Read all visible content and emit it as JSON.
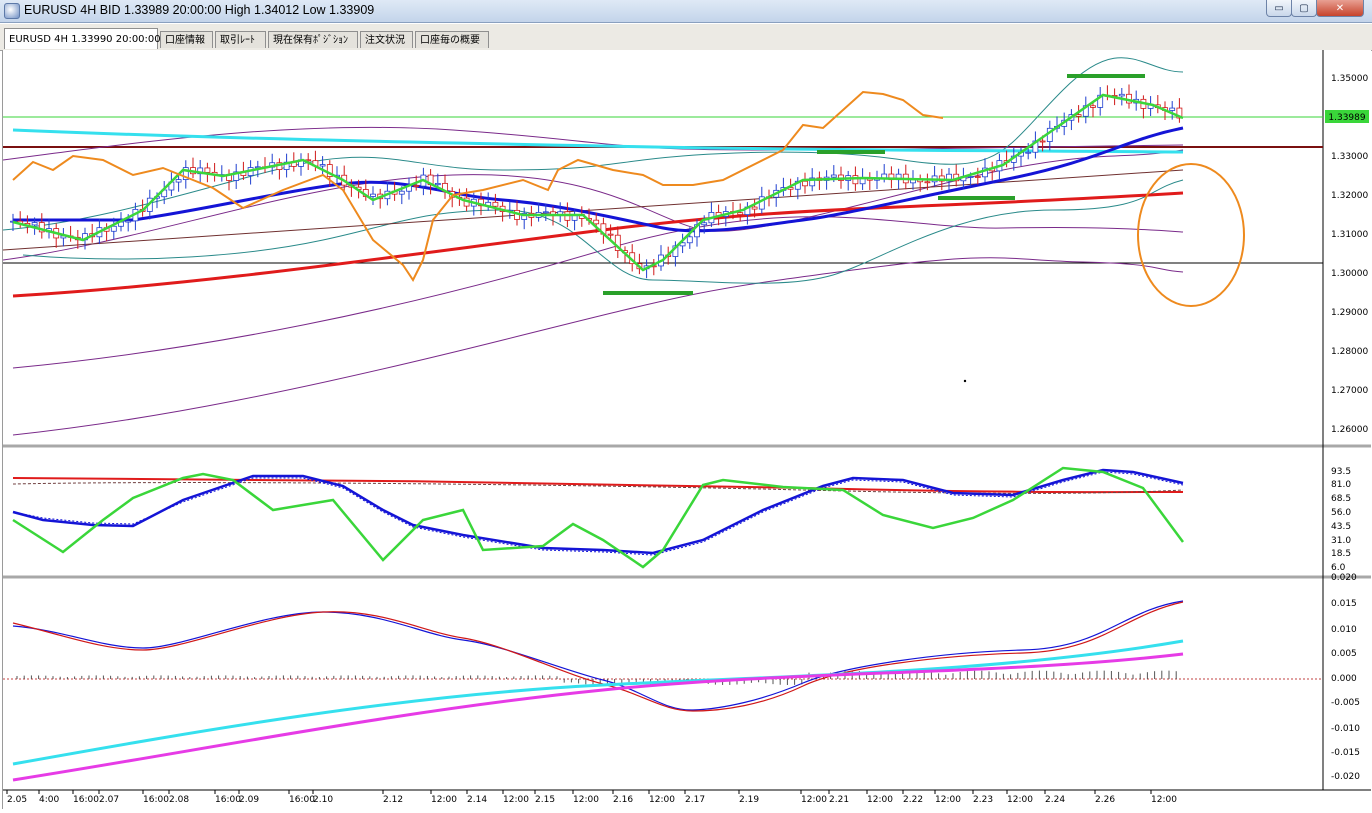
{
  "window": {
    "title": "EURUSD 4H BID 1.33989 20:00:00 High 1.34012 Low 1.33909",
    "buttons": {
      "minimize": "▭",
      "maximize": "▢",
      "close": "✕"
    }
  },
  "tabs": [
    {
      "label": "EURUSD 4H 1.33990 20:00:00"
    },
    {
      "label": "口座情報"
    },
    {
      "label": "取引ﾚｰﾄ"
    },
    {
      "label": "現在保有ﾎﾟｼﾞｼｮﾝ"
    },
    {
      "label": "注文状況"
    },
    {
      "label": "口座毎の概要"
    }
  ],
  "price_axis": {
    "labels": [
      "1.35000",
      "1.34000",
      "1.33000",
      "1.32000",
      "1.31000",
      "1.30000",
      "1.29000",
      "1.28000",
      "1.27000",
      "1.26000"
    ],
    "current": "1.33989"
  },
  "osc_axis": {
    "labels": [
      "93.5",
      "81.0",
      "68.5",
      "56.0",
      "43.5",
      "31.0",
      "18.5",
      "6.0"
    ]
  },
  "macd_axis": {
    "labels": [
      "0.020",
      "0.015",
      "0.010",
      "0.005",
      "0.000",
      "-0.005",
      "-0.010",
      "-0.015",
      "-0.020"
    ]
  },
  "time_axis": {
    "labels": [
      "2.05",
      "4:00",
      "16:00",
      "2.07",
      "16:00",
      "2.08",
      "16:00",
      "2.09",
      "16:00",
      "2.10",
      "2.12",
      "12:00",
      "2.14",
      "12:00",
      "2.15",
      "12:00",
      "2.16",
      "12:00",
      "2.17",
      "2.19",
      "12:00",
      "2.21",
      "12:00",
      "2.22",
      "12:00",
      "2.23",
      "12:00",
      "2.24",
      "2.26",
      "12:00"
    ]
  },
  "colors": {
    "candle_up": "#1f3fcf",
    "candle_down": "#d01818",
    "orange_line": "#ee8a1e",
    "green_line": "#3ad63a",
    "blue_ma": "#1414d6",
    "red_ma": "#e01b1b",
    "purple_band": "#7a2a8a",
    "teal_band": "#2a8a8a",
    "cyan_line": "#35e0ee",
    "magenta_line": "#e63be6",
    "highlight_green": "#2aa02a"
  }
}
